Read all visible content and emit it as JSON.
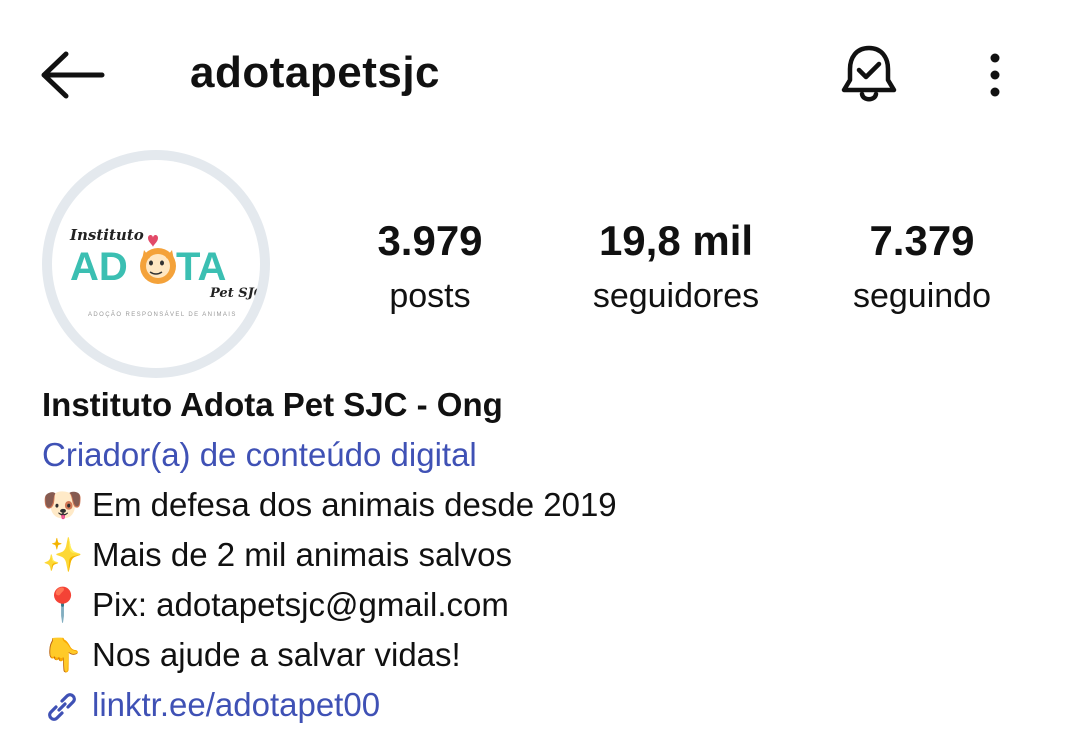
{
  "header": {
    "username": "adotapetsjc",
    "back_icon": "arrow-left-icon",
    "notification_icon": "bell-check-icon",
    "more_icon": "more-vertical-icon"
  },
  "avatar": {
    "logo_text": "Instituto ADOTA Pet SJC",
    "logo_tagline": "ADOÇÃO RESPONSÁVEL DE ANIMAIS"
  },
  "stats": {
    "posts": {
      "value": "3.979",
      "label": "posts"
    },
    "followers": {
      "value": "19,8 mil",
      "label": "seguidores"
    },
    "following": {
      "value": "7.379",
      "label": "seguindo"
    }
  },
  "bio": {
    "name": "Instituto Adota Pet SJC - Ong",
    "category": "Criador(a) de conteúdo digital",
    "lines": [
      {
        "emoji": "🐶",
        "text": "Em defesa dos animais desde 2019"
      },
      {
        "emoji": "✨",
        "text": "Mais de 2 mil animais salvos"
      },
      {
        "emoji": "📍",
        "text": "Pix: adotapetsjc@gmail.com"
      },
      {
        "emoji": "👇",
        "text": "Nos ajude a salvar vidas!"
      }
    ],
    "link": "linktr.ee/adotapet00",
    "link_icon": "link-icon"
  },
  "colors": {
    "link": "#3f51b5",
    "logo_teal": "#3bbfb2",
    "logo_orange": "#f4a23a"
  }
}
